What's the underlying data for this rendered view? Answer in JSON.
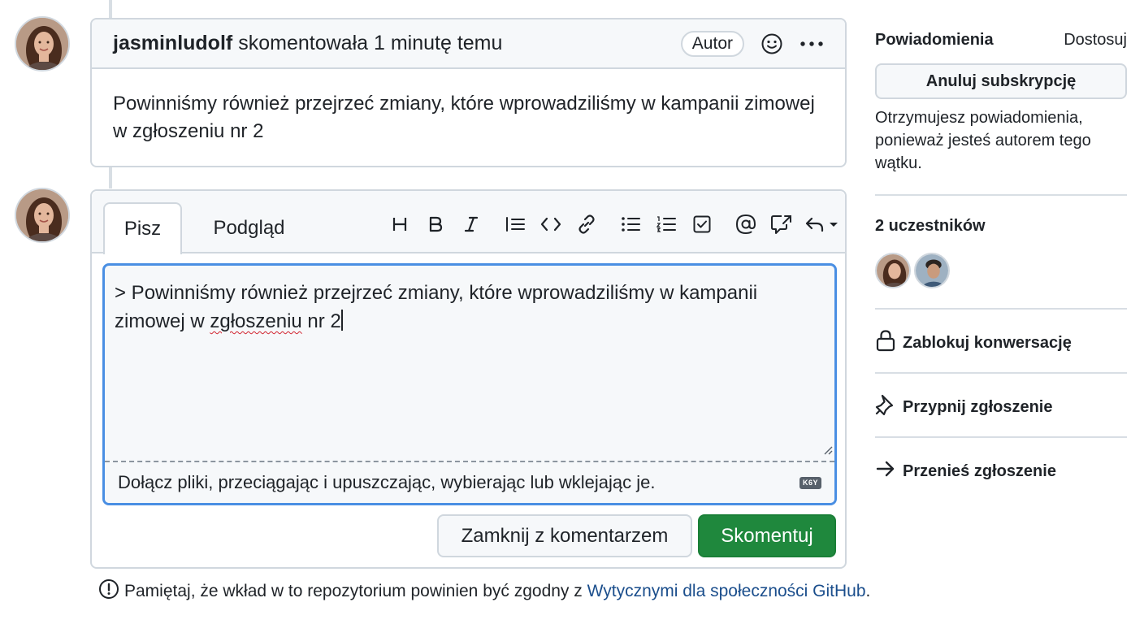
{
  "comment": {
    "author": "jasminludolf",
    "meta": "skomentowała 1 minutę temu",
    "badge": "Autor",
    "body": "Powinniśmy również przejrzeć zmiany, które wprowadziliśmy w kampanii zimowej w zgłoszeniu nr 2"
  },
  "editor": {
    "tabs": [
      {
        "label": "Pisz",
        "active": true
      },
      {
        "label": "Podgląd",
        "active": false
      }
    ],
    "toolbar_icons": [
      "heading-icon",
      "bold-icon",
      "italic-icon",
      "quote-icon",
      "code-icon",
      "link-icon",
      "unordered-list-icon",
      "ordered-list-icon",
      "task-list-icon",
      "mention-icon",
      "reference-icon",
      "reply-icon"
    ],
    "text_line1": "> Powinniśmy również przejrzeć zmiany, które wprowadziliśmy w kampanii",
    "text_line2_pre": "zimowej w ",
    "text_line2_misspelled": "zgłoszeniu",
    "text_line2_post": " nr 2",
    "attach_hint": "Dołącz pliki, przeciągając i upuszczając, wybierając lub wklejając je.",
    "md_badge": "K6Y",
    "close_button": "Zamknij z komentarzem",
    "comment_button": "Skomentuj"
  },
  "footer": {
    "text": "Pamiętaj, że wkład w to repozytorium powinien być zgodny z",
    "link": "Wytycznymi dla społeczności GitHub",
    "end": "."
  },
  "sidebar": {
    "notifications_title": "Powiadomienia",
    "customize": "Dostosuj",
    "unsubscribe": "Anuluj subskrypcję",
    "reason": "Otrzymujesz powiadomienia, ponieważ jesteś autorem tego wątku.",
    "participants_title": "2 uczestników",
    "lock": "Zablokuj konwersację",
    "pin": "Przypnij zgłoszenie",
    "transfer": "Przenieś zgłoszenie"
  },
  "colors": {
    "primary_green": "#1f883d",
    "focus_blue": "#4a8fe3",
    "border": "#d0d7de",
    "link": "#1b4e8c"
  }
}
